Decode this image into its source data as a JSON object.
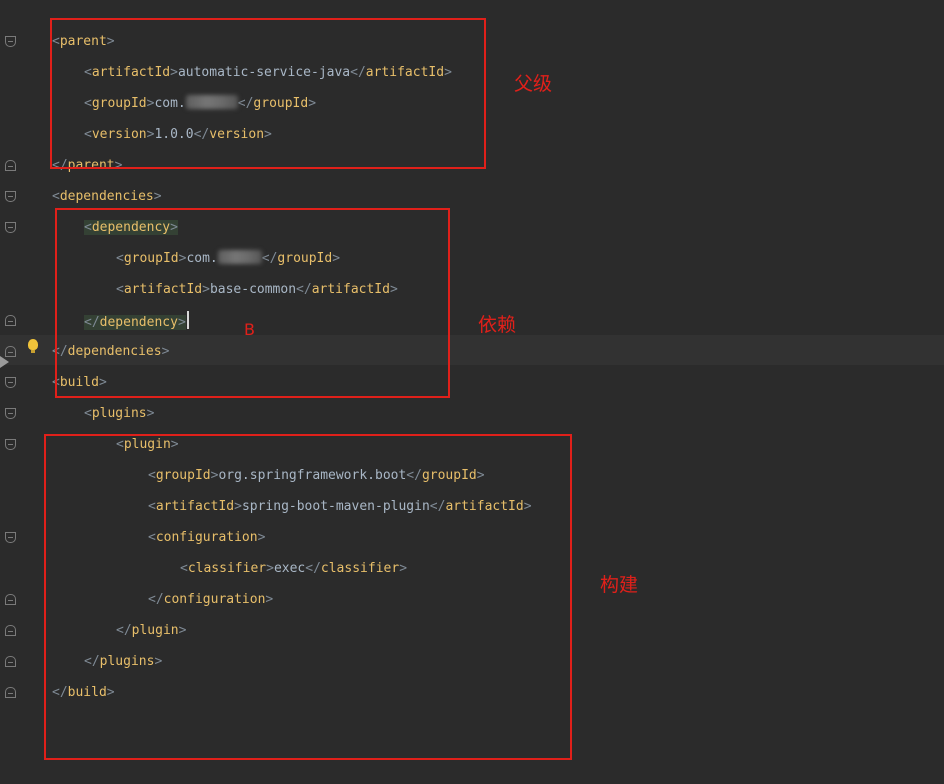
{
  "editor": {
    "lines": [
      {
        "indent": 0,
        "open": "parent",
        "text": "",
        "close": ""
      },
      {
        "indent": 1,
        "open": "artifactId",
        "text": "automatic-service-java",
        "close": "artifactId"
      },
      {
        "indent": 1,
        "open": "groupId",
        "text": "com.",
        "close": "groupId",
        "redacted": true
      },
      {
        "indent": 1,
        "open": "version",
        "text": "1.0.0",
        "close": "version"
      },
      {
        "indent": 0,
        "close_only": "parent"
      },
      {
        "indent": 0,
        "open": "dependencies"
      },
      {
        "indent": 1,
        "open": "dependency",
        "highlighted": true
      },
      {
        "indent": 2,
        "open": "groupId",
        "text": "com.",
        "close": "groupId",
        "redacted": true
      },
      {
        "indent": 2,
        "open": "artifactId",
        "text": "base-common",
        "close": "artifactId"
      },
      {
        "indent": 1,
        "close_only": "dependency",
        "highlighted": true,
        "caret": true
      },
      {
        "indent": 0,
        "close_only": "dependencies"
      },
      {
        "indent": 0,
        "open": "build"
      },
      {
        "indent": 1,
        "open": "plugins"
      },
      {
        "indent": 2,
        "open": "plugin"
      },
      {
        "indent": 3,
        "open": "groupId",
        "text": "org.springframework.boot",
        "close": "groupId"
      },
      {
        "indent": 3,
        "open": "artifactId",
        "text": "spring-boot-maven-plugin",
        "close": "artifactId"
      },
      {
        "indent": 3,
        "open": "configuration"
      },
      {
        "indent": 4,
        "open": "classifier",
        "text": "exec",
        "close": "classifier"
      },
      {
        "indent": 3,
        "close_only": "configuration"
      },
      {
        "indent": 2,
        "close_only": "plugin"
      },
      {
        "indent": 1,
        "close_only": "plugins"
      },
      {
        "indent": 0,
        "close_only": "build"
      }
    ]
  },
  "annotations": {
    "parent_label": "父级",
    "dependencies_label": "依赖",
    "build_label": "构建",
    "marker": "B"
  },
  "colors": {
    "background": "#2b2b2b",
    "tag": "#e8bf6a",
    "text": "#a9b7c6",
    "annotation": "#e0201a",
    "highlight": "#344134"
  }
}
